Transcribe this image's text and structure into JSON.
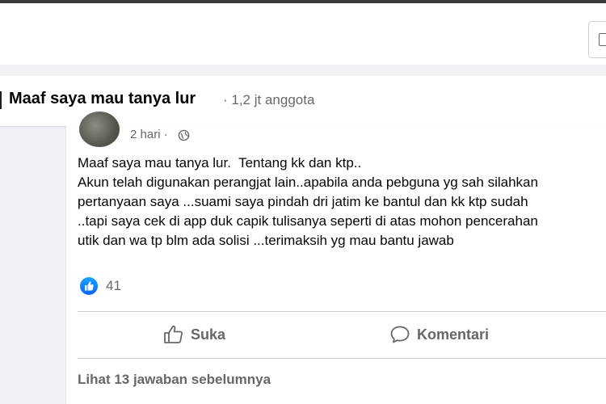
{
  "group": {
    "name": "Maaf saya mau tanya lur",
    "meta": "· 1,2 jt anggota"
  },
  "post": {
    "timestamp": "2 hari ·",
    "lines": [
      "Maaf saya mau tanya lur.  Tentang kk dan ktp..",
      "Akun telah digunakan perangjat lain..apabila anda pebguna yg sah silahkan",
      "pertanyaan saya ...suami saya pindah dri jatim ke bantul dan kk ktp sudah",
      "..tapi saya cek di app duk capik tulisanya seperti di atas mohon pencerahan",
      "utik dan wa tp blm ada solisi ...terimaksih yg mau bantu jawab"
    ],
    "reaction_count": "41"
  },
  "actions": {
    "like_label": "Suka",
    "comment_label": "Komentari"
  },
  "replies": {
    "view_previous_label": "Lihat 13 jawaban sebelumnya"
  },
  "colors": {
    "accent_blue": "#0866ff",
    "secondary_text": "#65676b",
    "background": "#f0f2f5"
  },
  "icons": {
    "audience": "globe-icon",
    "reaction": "like-reaction-icon",
    "like_button": "thumbs-up-icon",
    "comment_button": "comment-bubble-icon"
  }
}
